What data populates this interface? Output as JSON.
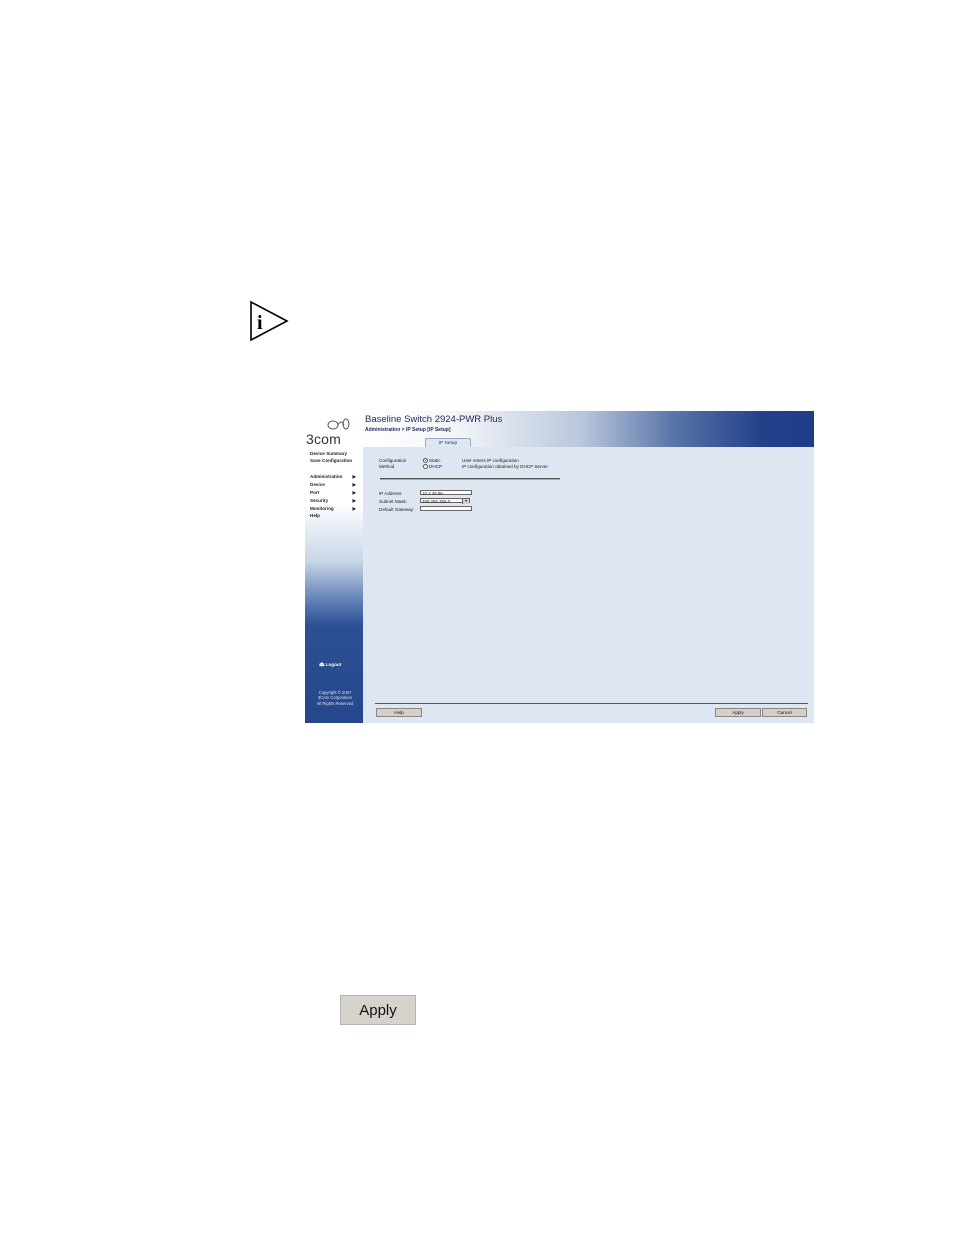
{
  "app": {
    "title": "Baseline Switch 2924-PWR Plus",
    "breadcrumb": "Administration > IP Setup [IP Setup]",
    "logo_text": "3com"
  },
  "sidebar": {
    "links": [
      "Device Summary",
      "Save Configuration"
    ],
    "menu": [
      {
        "label": "Administration",
        "has_arrow": true
      },
      {
        "label": "Device",
        "has_arrow": true
      },
      {
        "label": "Port",
        "has_arrow": true
      },
      {
        "label": "Security",
        "has_arrow": true
      },
      {
        "label": "Monitoring",
        "has_arrow": true
      },
      {
        "label": "Help",
        "has_arrow": false
      }
    ],
    "arrow_glyph": "▶",
    "logout_label": "Logout",
    "copyright": [
      "Copyright © 2007",
      "3Com Corporation",
      "All Rights Reserved"
    ]
  },
  "tabs": [
    {
      "label": "IP Setup",
      "active": true
    }
  ],
  "form": {
    "config_label_line1": "Configuration",
    "config_label_line2": "Method",
    "options": [
      {
        "label": "Static",
        "selected": true,
        "description": "User enters IP configuration"
      },
      {
        "label": "DHCP",
        "selected": false,
        "description": "IP configuration obtained by DHCP Server"
      }
    ],
    "ip_address_label": "IP Address:",
    "ip_address_value": "10.2.48.96",
    "subnet_mask_label": "Subnet Mask:",
    "subnet_mask_value": "255.255.255.0",
    "default_gateway_label": "Default Gateway:",
    "default_gateway_value": ""
  },
  "buttons": {
    "help": "Help",
    "apply": "Apply",
    "cancel": "Cancel"
  },
  "apply_button_large": "Apply",
  "colors": {
    "header_dark": "#1e3d86",
    "content_bg": "#dde6f1",
    "button_bg": "#d4d0c8"
  }
}
